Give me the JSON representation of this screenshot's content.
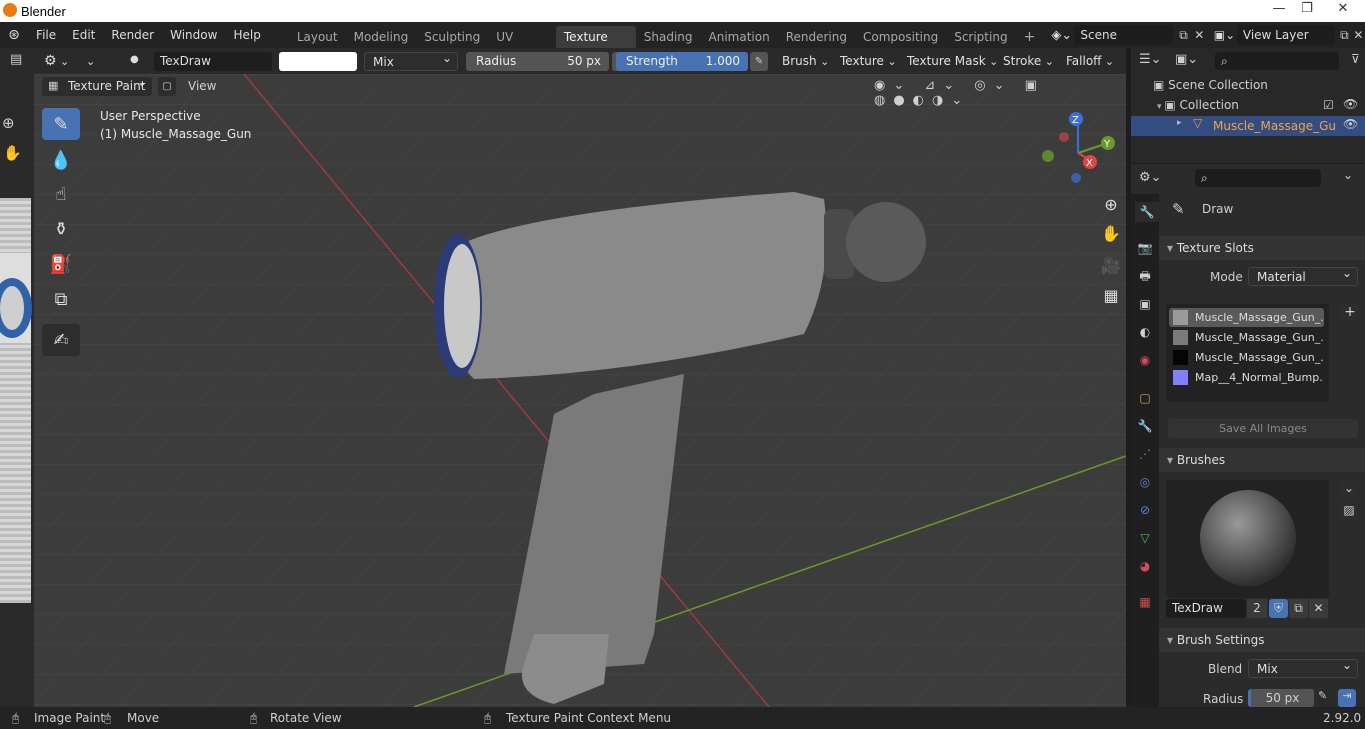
{
  "window": {
    "title": "Blender",
    "min": "—",
    "max": "❐",
    "close": "✕"
  },
  "menu": [
    "File",
    "Edit",
    "Render",
    "Window",
    "Help"
  ],
  "workspaces": [
    {
      "label": "Layout"
    },
    {
      "label": "Modeling"
    },
    {
      "label": "Sculpting"
    },
    {
      "label": "UV Editing"
    },
    {
      "label": "Texture Paint",
      "active": true
    },
    {
      "label": "Shading"
    },
    {
      "label": "Animation"
    },
    {
      "label": "Rendering"
    },
    {
      "label": "Compositing"
    },
    {
      "label": "Scripting"
    }
  ],
  "add_workspace": "+",
  "scene": {
    "label": "Scene"
  },
  "view_layer": {
    "label": "View Layer"
  },
  "toolhdr": {
    "brush_name": "TexDraw",
    "blend": "Mix",
    "radius_label": "Radius",
    "radius_value": "50 px",
    "strength_label": "Strength",
    "strength_value": "1.000",
    "strength_fraction": 1.0,
    "menus": [
      "Brush",
      "Texture",
      "Texture Mask",
      "Stroke",
      "Falloff"
    ]
  },
  "viewhdr": {
    "mode": "Texture Paint",
    "view": "View"
  },
  "viewport": {
    "perspective": "User Perspective",
    "object": "(1) Muscle_Massage_Gun",
    "gizmo": {
      "z": "Z",
      "y": "Y",
      "x": "X"
    }
  },
  "outliner": {
    "scene_collection": "Scene Collection",
    "collection": "Collection",
    "object": "Muscle_Massage_Gu"
  },
  "properties": {
    "tool": "Draw",
    "texture_slots": {
      "title": "Texture Slots",
      "mode_label": "Mode",
      "mode_value": "Material",
      "slots": [
        {
          "name": "Muscle_Massage_Gun_...",
          "color": "#9a9a9a",
          "selected": true
        },
        {
          "name": "Muscle_Massage_Gun_...",
          "color": "#7a7a7a"
        },
        {
          "name": "Muscle_Massage_Gun_...",
          "color": "#050505"
        },
        {
          "name": "Map__4_Normal_Bump....",
          "color": "#8080ff"
        }
      ],
      "save_all": "Save All Images"
    },
    "brushes": {
      "title": "Brushes",
      "name": "TexDraw",
      "users": "2"
    },
    "brush_settings": {
      "title": "Brush Settings",
      "blend_label": "Blend",
      "blend_value": "Mix",
      "radius_label": "Radius",
      "radius_value": "50 px"
    }
  },
  "statusbar": {
    "left": "Image Paint",
    "move": "Move",
    "rotate": "Rotate View",
    "context": "Texture Paint Context Menu",
    "version": "2.92.0"
  }
}
